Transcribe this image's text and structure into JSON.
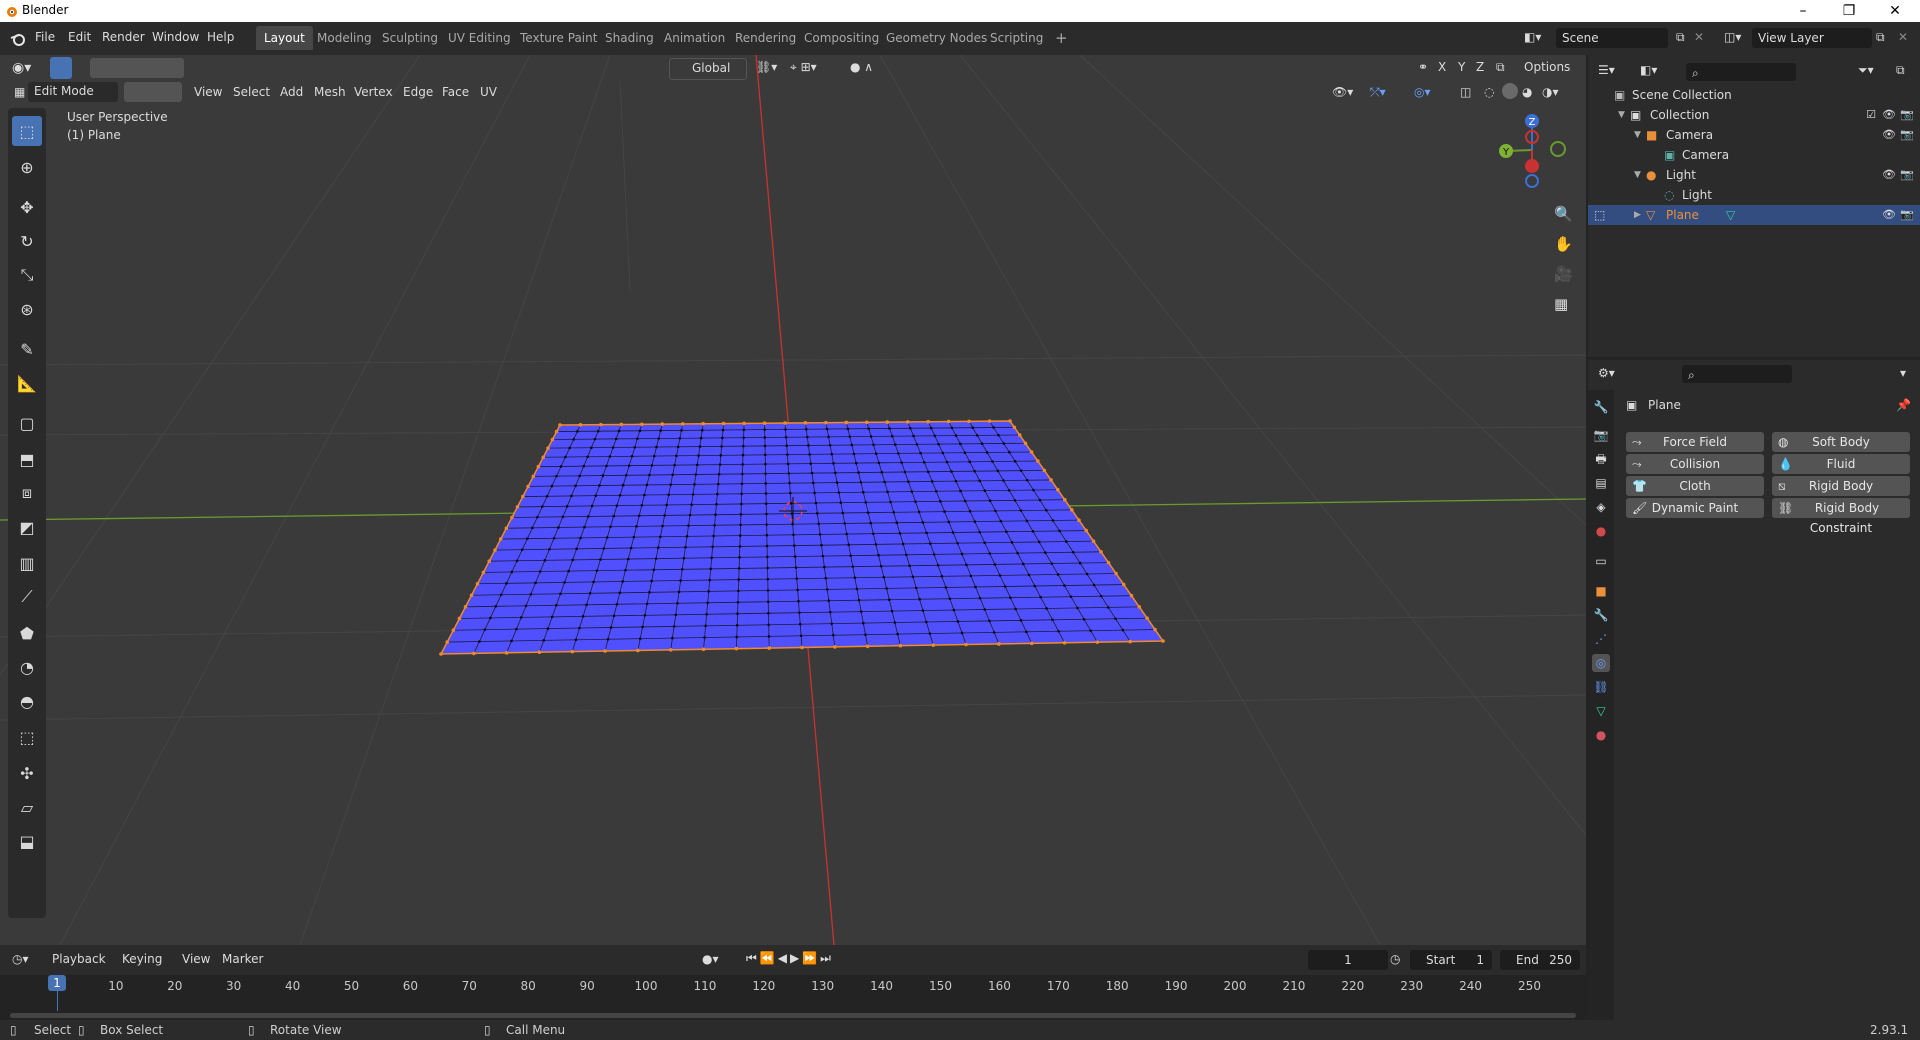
{
  "window": {
    "title": "Blender"
  },
  "menu": [
    "File",
    "Edit",
    "Render",
    "Window",
    "Help"
  ],
  "workspaces": [
    "Layout",
    "Modeling",
    "Sculpting",
    "UV Editing",
    "Texture Paint",
    "Shading",
    "Animation",
    "Rendering",
    "Compositing",
    "Geometry Nodes",
    "Scripting"
  ],
  "active_workspace": "Layout",
  "scene": {
    "name": "Scene",
    "view_layer": "View Layer"
  },
  "viewport_header": {
    "transform_orientation": "Global",
    "options_label": "Options",
    "axis_x": "X",
    "axis_y": "Y",
    "axis_z": "Z",
    "mode": "Edit Mode",
    "menus": [
      "View",
      "Select",
      "Add",
      "Mesh",
      "Vertex",
      "Edge",
      "Face",
      "UV"
    ]
  },
  "viewport_overlay": {
    "perspective": "User Perspective",
    "object": "(1) Plane"
  },
  "gizmo": {
    "z": "Z",
    "y": "Y"
  },
  "outliner": {
    "root": "Scene Collection",
    "items": [
      {
        "label": "Collection",
        "depth": 1
      },
      {
        "label": "Camera",
        "depth": 2
      },
      {
        "label": "Camera",
        "depth": 3
      },
      {
        "label": "Light",
        "depth": 2
      },
      {
        "label": "Light",
        "depth": 3
      },
      {
        "label": "Plane",
        "depth": 2
      }
    ]
  },
  "properties": {
    "object_name": "Plane",
    "physics_buttons": [
      {
        "label": "Force Field",
        "icon": "force-field-icon"
      },
      {
        "label": "Soft Body",
        "icon": "soft-body-icon"
      },
      {
        "label": "Collision",
        "icon": "collision-icon"
      },
      {
        "label": "Fluid",
        "icon": "fluid-icon"
      },
      {
        "label": "Cloth",
        "icon": "cloth-icon"
      },
      {
        "label": "Rigid Body",
        "icon": "rigid-body-icon"
      },
      {
        "label": "Dynamic Paint",
        "icon": "dynamic-paint-icon"
      },
      {
        "label": "Rigid Body Constraint",
        "icon": "rigid-body-constraint-icon"
      }
    ]
  },
  "timeline": {
    "menus": [
      "Playback",
      "Keying",
      "View",
      "Marker"
    ],
    "current_frame": "1",
    "start_label": "Start",
    "start": "1",
    "end_label": "End",
    "end": "250",
    "ticks": [
      "10",
      "20",
      "30",
      "40",
      "50",
      "60",
      "70",
      "80",
      "90",
      "100",
      "110",
      "120",
      "130",
      "140",
      "150",
      "160",
      "170",
      "180",
      "190",
      "200",
      "210",
      "220",
      "230",
      "240",
      "250"
    ],
    "playhead": "1"
  },
  "statusbar": {
    "select": "Select",
    "box_select": "Box Select",
    "rotate_view": "Rotate View",
    "call_menu": "Call Menu",
    "version": "2.93.1"
  },
  "colors": {
    "accent": "#4772b3",
    "mesh_face": "#5050ff",
    "selected_row": "#334d80",
    "x_axis": "#c83232",
    "y_axis": "#6a9a2e"
  }
}
